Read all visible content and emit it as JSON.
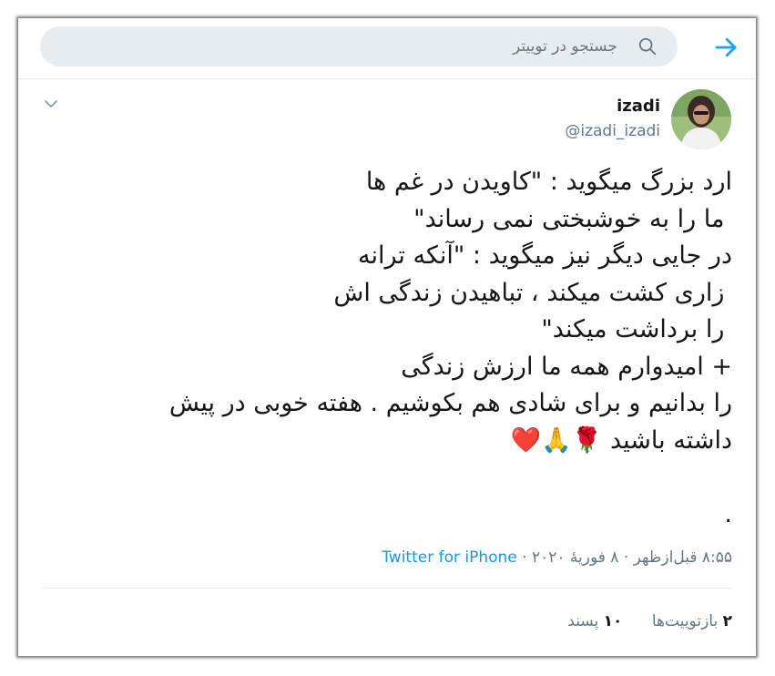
{
  "colors": {
    "accent": "#1da1f2",
    "link": "#1b95e0",
    "muted": "#657786",
    "text": "#14171a",
    "search_bg": "#e6ecf0"
  },
  "header": {
    "back_icon": "arrow-right-icon",
    "search": {
      "placeholder": "جستجو در توییتر",
      "icon": "search-icon"
    }
  },
  "tweet": {
    "menu_icon": "chevron-down-icon",
    "author": {
      "display_name": "izadi",
      "handle": "@izadi_izadi",
      "avatar_icon": "avatar"
    },
    "text": "ارد بزرگ میگوید : \"کاویدن در غم ها\n ما را به خوشبختی نمی رساند\"\nدر جایی دیگر نیز میگوید : \"آنکه ترانه\n زاری کشت میکند ، تباهیدن زندگی اش\n را برداشت میکند\"\n+ امیدوارم همه ما ارزش زندگی\nرا بدانیم و برای شادی هم بکوشیم . هفته خوبی در پیش\nداشته باشید 🌹🙏❤️\n\n.",
    "time": "۸:۵۵ قبل‌ازظهر",
    "separator": " · ",
    "date": "۸ فوریهٔ ۲۰۲۰",
    "source": "Twitter for iPhone",
    "retweets": {
      "count": "۲",
      "label": "بازتوییت‌ها"
    },
    "likes": {
      "count": "۱۰",
      "label": "پسند"
    }
  }
}
